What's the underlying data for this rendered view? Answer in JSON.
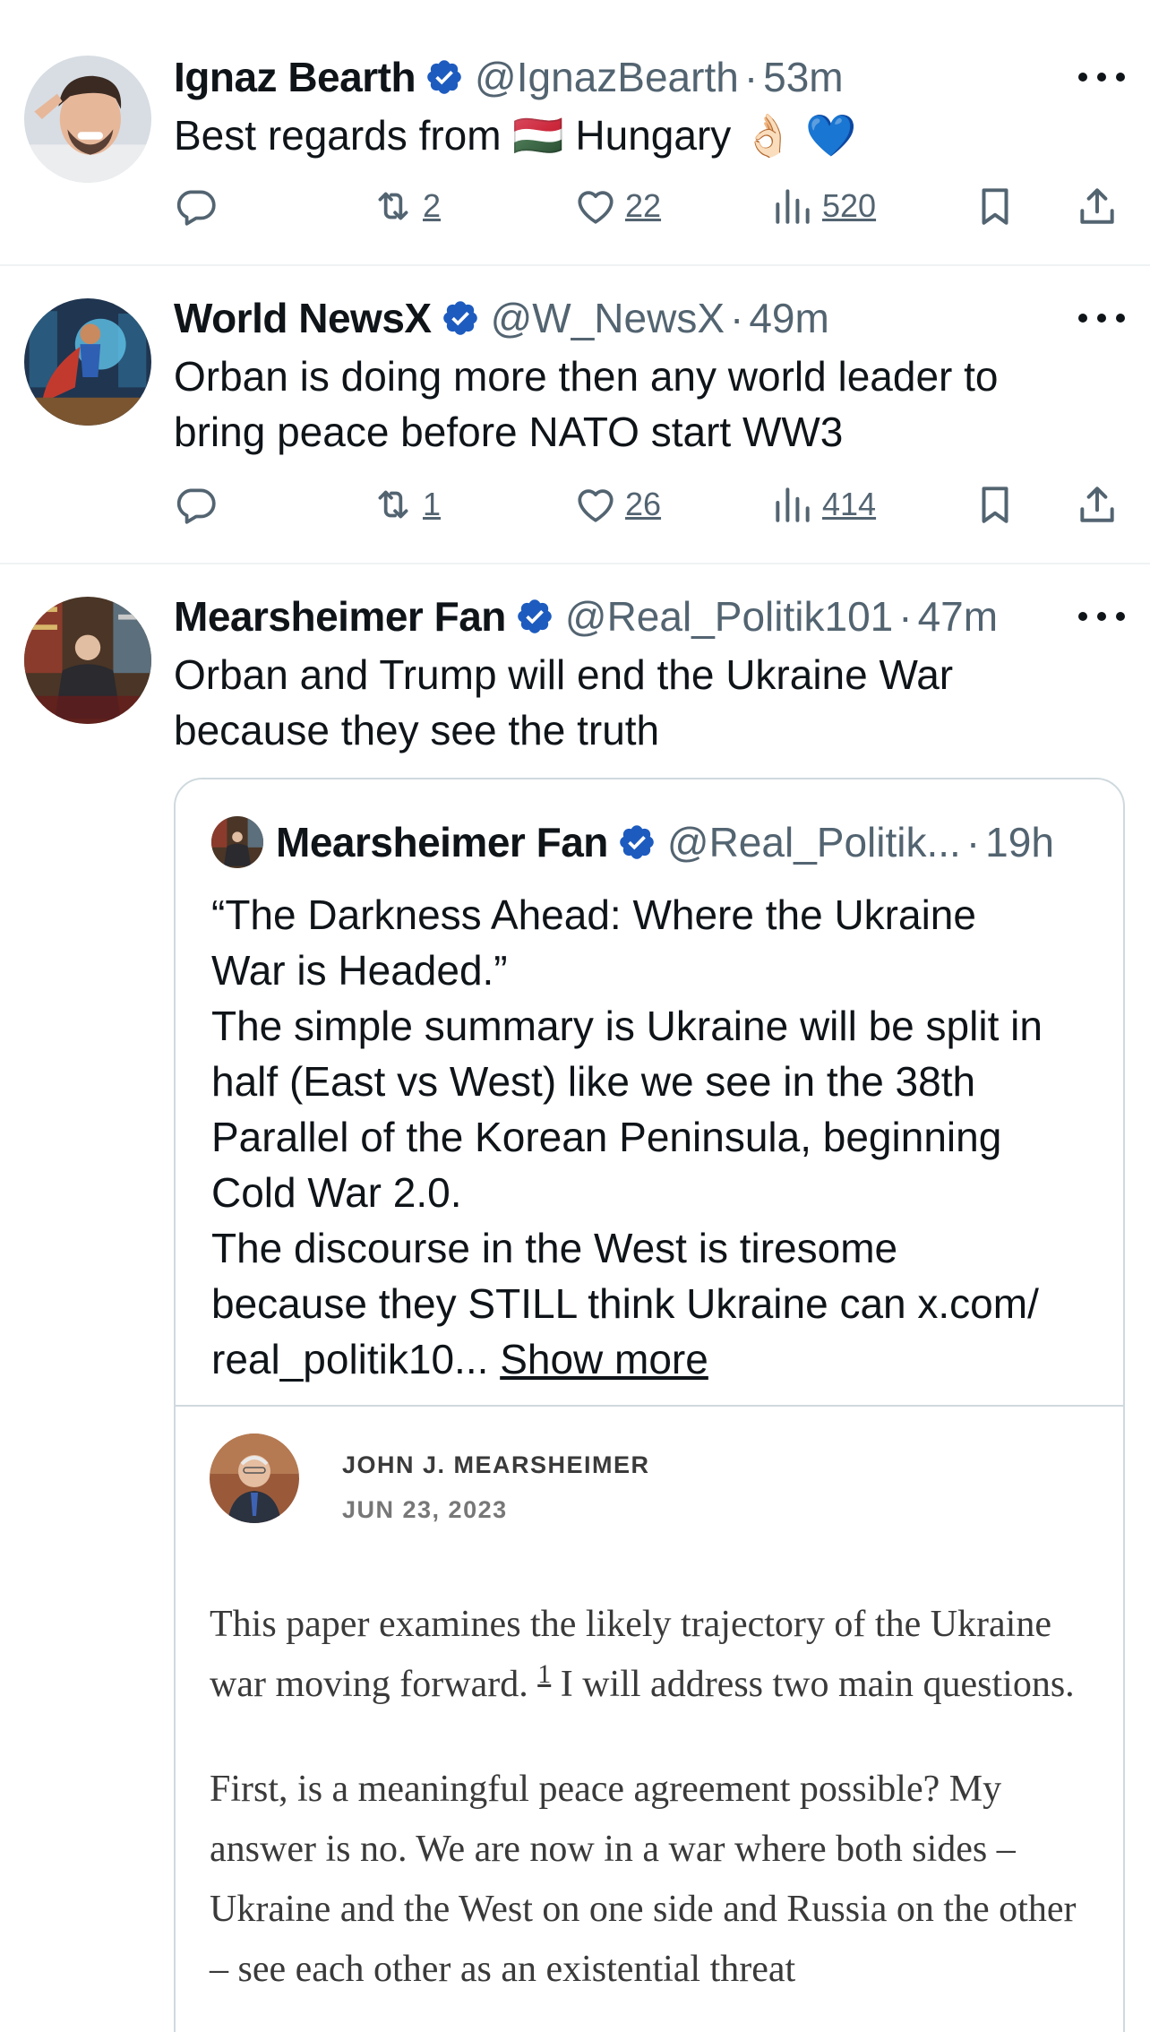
{
  "tweets": [
    {
      "name": "Ignaz Bearth",
      "handle": "@IgnazBearth",
      "separator": "·",
      "time": "53m",
      "text": "Best regards from 🇭🇺 Hungary 👌🏻 💙",
      "retweets": "2",
      "likes": "22",
      "views": "520"
    },
    {
      "name": "World NewsX",
      "handle": "@W_NewsX",
      "separator": "·",
      "time": "49m",
      "text": "Orban is doing more then any world leader to\nbring peace before NATO start WW3",
      "retweets": "1",
      "likes": "26",
      "views": "414"
    },
    {
      "name": "Mearsheimer Fan",
      "handle": "@Real_Politik101",
      "separator": "·",
      "time": "47m",
      "text": "Orban and Trump will end the Ukraine War\nbecause they see the truth"
    }
  ],
  "quote": {
    "name": "Mearsheimer Fan",
    "handle": "@Real_Politik...",
    "separator": "·",
    "time": "19h",
    "text": "“The Darkness Ahead: Where the Ukraine\nWar is Headed.”\nThe simple summary is Ukraine will be split in\nhalf (East vs West) like we see in the 38th\nParallel of the Korean Peninsula, beginning\nCold War 2.0.\nThe discourse in the West is tiresome\nbecause they STILL think Ukraine can x.com/\nreal_politik10... ",
    "show_more": "Show more",
    "article": {
      "author": "JOHN J. MEARSHEIMER",
      "date": "JUN 23, 2023",
      "para1_a": "This paper examines the likely trajectory of the Ukraine war moving forward.",
      "footnote": "1",
      "para1_b": " I will address two main questions.",
      "para2": "First, is a meaningful peace agreement possible? My answer is no. We are now in a war where both sides – Ukraine and the West on one side and Russia on the other – see each other as an existential threat"
    }
  },
  "icons": {
    "verified": "verified-badge-icon",
    "reply": "reply-icon",
    "retweet": "retweet-icon",
    "like": "heart-icon",
    "views": "views-icon",
    "bookmark": "bookmark-icon",
    "share": "share-icon",
    "more": "more-icon"
  },
  "colors": {
    "verified": "#1d5bbf",
    "text": "#0f1419",
    "secondary": "#536471",
    "border": "#cfd9de"
  }
}
